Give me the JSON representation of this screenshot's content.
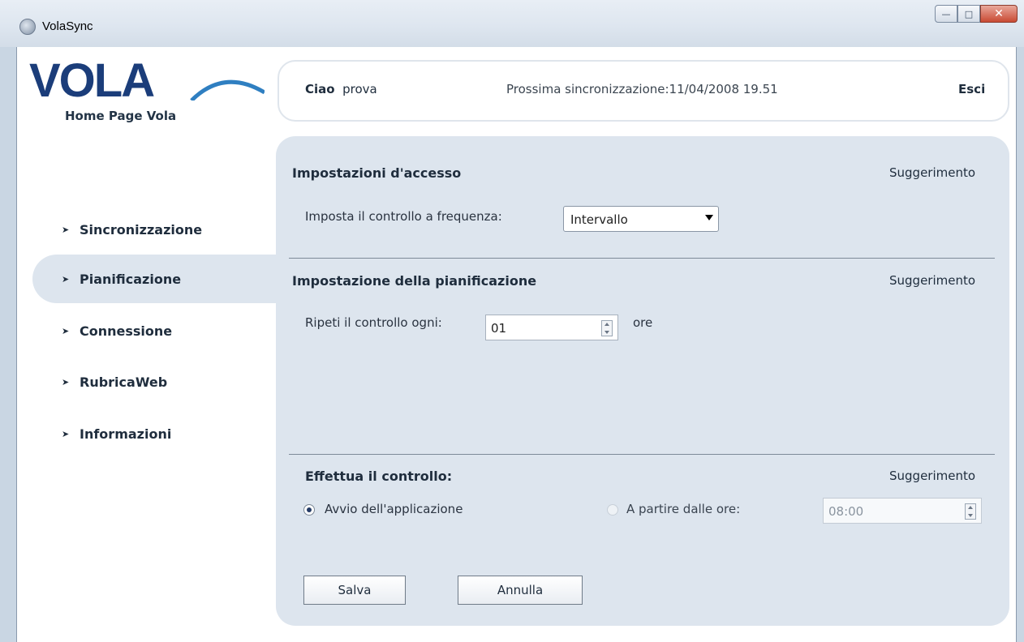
{
  "window": {
    "title": "VolaSync"
  },
  "logo": {
    "text": "VOLA",
    "home_link": "Home Page Vola"
  },
  "header": {
    "greeting": "Ciao",
    "user": "prova",
    "next_sync": "Prossima sincronizzazione:11/04/2008 19.51",
    "logout": "Esci"
  },
  "nav": [
    {
      "label": "Sincronizzazione",
      "active": false
    },
    {
      "label": "Pianificazione",
      "active": true
    },
    {
      "label": "Connessione",
      "active": false
    },
    {
      "label": "RubricaWeb",
      "active": false
    },
    {
      "label": "Informazioni",
      "active": false
    }
  ],
  "access": {
    "title": "Impostazioni d'accesso",
    "hint": "Suggerimento",
    "frequency_label": "Imposta il controllo a frequenza:",
    "frequency_value": "Intervallo"
  },
  "schedule": {
    "title": "Impostazione della pianificazione",
    "hint": "Suggerimento",
    "repeat_label": "Ripeti il controllo ogni:",
    "repeat_value": "01",
    "repeat_unit": "ore"
  },
  "check": {
    "title": "Effettua il controllo:",
    "hint": "Suggerimento",
    "option_startup": "Avvio dell'applicazione",
    "option_from": "A partire dalle ore:",
    "from_time": "08:00"
  },
  "buttons": {
    "save": "Salva",
    "cancel": "Annulla"
  },
  "colors": {
    "panel": "#dde5ee",
    "logo_blue": "#1b3d7a"
  }
}
